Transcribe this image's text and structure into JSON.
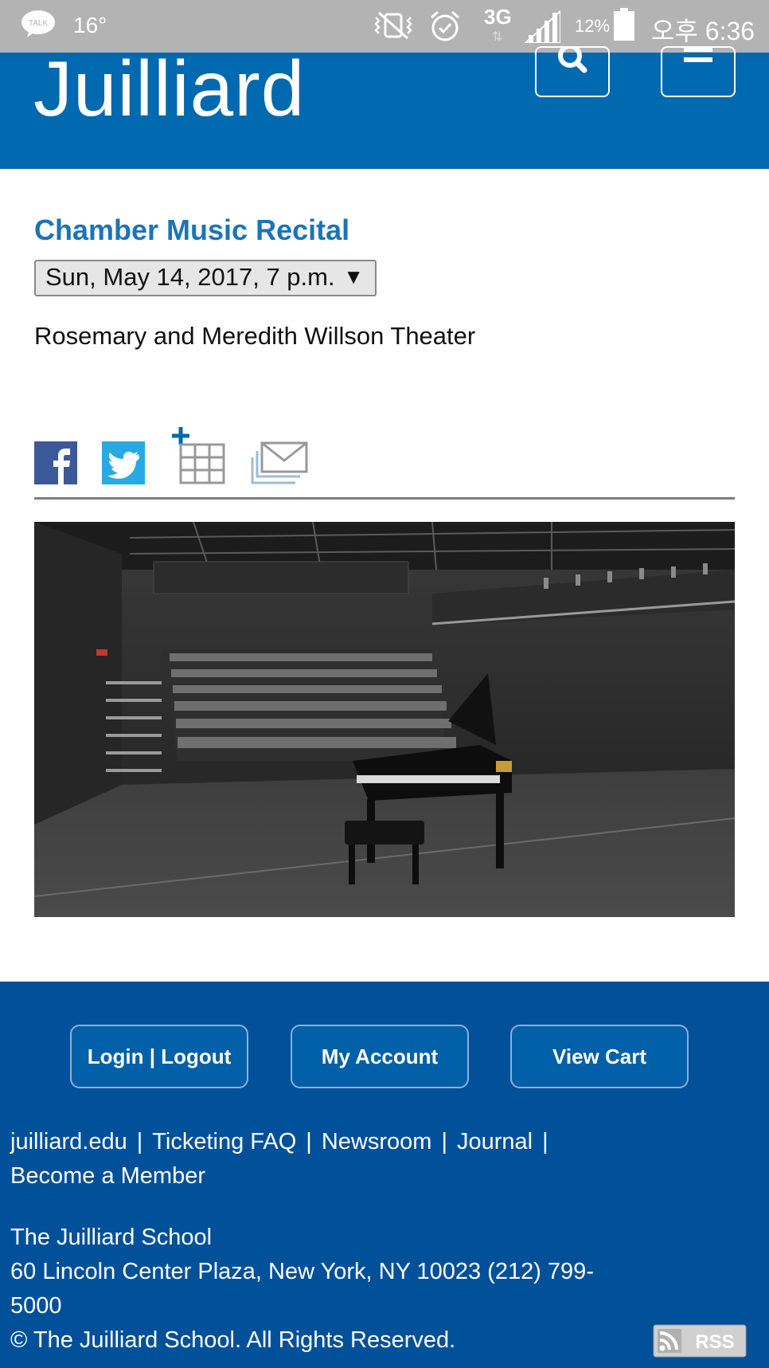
{
  "status_bar": {
    "talk_label": "TALK",
    "temperature": "16°",
    "network": "3G",
    "battery": "12%",
    "time": "오후 6:36"
  },
  "header": {
    "logo": "Juilliard"
  },
  "event": {
    "title": "Chamber Music Recital",
    "date_selected": "Sun, May 14, 2017, 7 p.m.",
    "venue": "Rosemary and Meredith Willson Theater"
  },
  "footer": {
    "buttons": {
      "login": "Login | Logout",
      "account": "My Account",
      "cart": "View Cart"
    },
    "links": [
      "juilliard.edu",
      "Ticketing FAQ",
      "Newsroom",
      "Journal",
      "Become a Member"
    ],
    "address": {
      "name": "The Juilliard School",
      "street": "60 Lincoln Center Plaza, New York, NY 10023 (212) 799-5000",
      "copyright": "© The Juilliard School. All Rights Reserved."
    },
    "rss": "RSS"
  },
  "colors": {
    "header_blue": "#0169b0",
    "footer_blue": "#01509a",
    "title_blue": "#1b74b8"
  }
}
